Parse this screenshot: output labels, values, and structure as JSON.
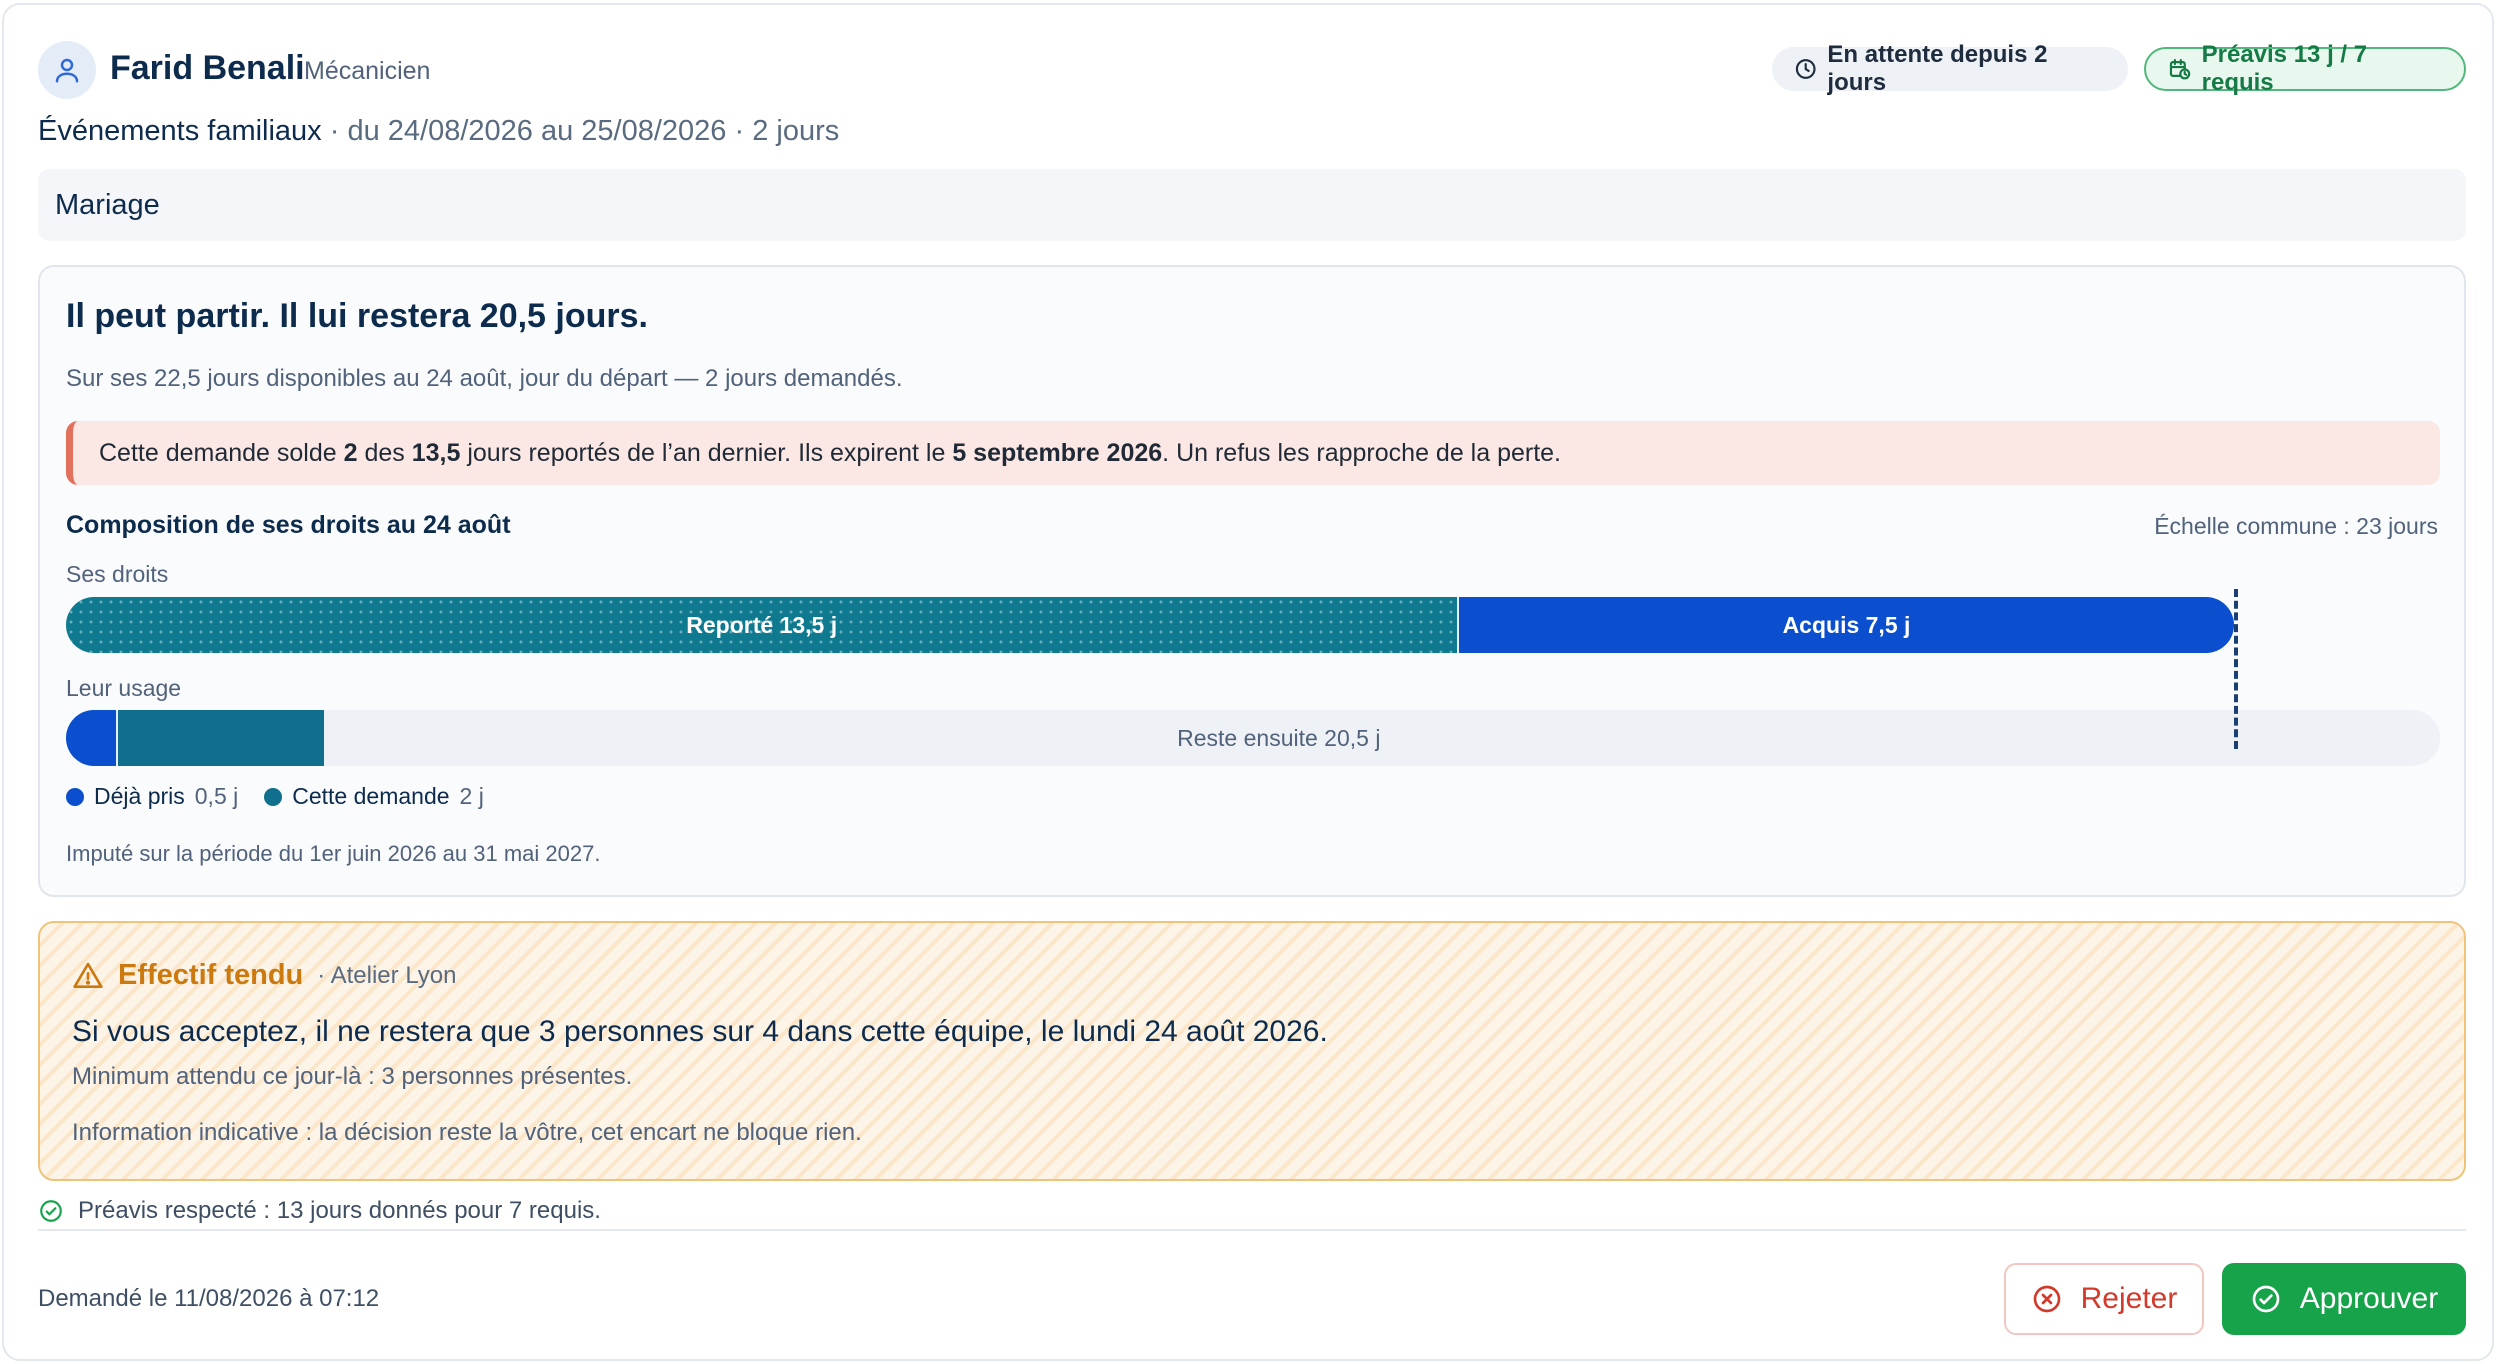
{
  "employee": {
    "name": "Farid Benali",
    "role": "Mécanicien"
  },
  "badges": {
    "waiting": "En attente depuis 2 jours",
    "notice": "Préavis 13 j / 7 requis"
  },
  "request": {
    "type": "Événements familiaux",
    "details": " · du 24/08/2026 au 25/08/2026 · 2 jours",
    "reason": "Mariage"
  },
  "balance": {
    "title": "Il peut partir. Il lui restera 20,5 jours.",
    "subtitle": "Sur ses 22,5 jours disponibles au 24 août, jour du départ — 2 jours demandés.",
    "alert": {
      "p1": "Cette demande solde ",
      "b1": "2",
      "p2": " des ",
      "b2": "13,5",
      "p3": " jours reportés de l’an dernier. Ils expirent le ",
      "b3": "5 septembre 2026",
      "p4": ". Un refus les rapproche de la perte."
    },
    "composition_title": "Composition de ses droits au 24 août",
    "scale_label": "Échelle commune : 23 jours",
    "rights_label": "Ses droits",
    "usage_label": "Leur usage",
    "rights": [
      {
        "label": "Reporté 13,5 j",
        "days": 13.5,
        "color": "#0f7a8f"
      },
      {
        "label": "Acquis 7,5 j",
        "days": 7.5,
        "color": "#0b4fce"
      }
    ],
    "usage": [
      {
        "label": "Déjà pris",
        "value": "0,5 j",
        "days": 0.5,
        "color": "#0b4fce"
      },
      {
        "label": "Cette demande",
        "value": "2 j",
        "days": 2,
        "color": "#0f6f8c"
      }
    ],
    "remaining_label": "Reste ensuite 20,5 j",
    "scale_days": 23,
    "marker_days": 21,
    "period": "Imputé sur la période du 1er juin 2026 au 31 mai 2027."
  },
  "staffing": {
    "title": "Effectif tendu",
    "site": "· Atelier Lyon",
    "main": "Si vous acceptez, il ne restera que 3 personnes sur 4 dans cette équipe, le lundi 24 août 2026.",
    "minimum": "Minimum attendu ce jour-là : 3 personnes présentes.",
    "info": "Information indicative : la décision reste la vôtre, cet encart ne bloque rien."
  },
  "notice_ok": "Préavis respecté : 13 jours donnés pour 7 requis.",
  "footer": {
    "requested_at": "Demandé le 11/08/2026 à 07:12",
    "reject_label": "Rejeter",
    "approve_label": "Approuver"
  },
  "colors": {
    "accent_blue": "#0b4fce",
    "carry_teal": "#0f7a8f",
    "approve_green": "#16a34a",
    "reject_red": "#d23a2c",
    "warn_orange": "#cc7a0f"
  }
}
